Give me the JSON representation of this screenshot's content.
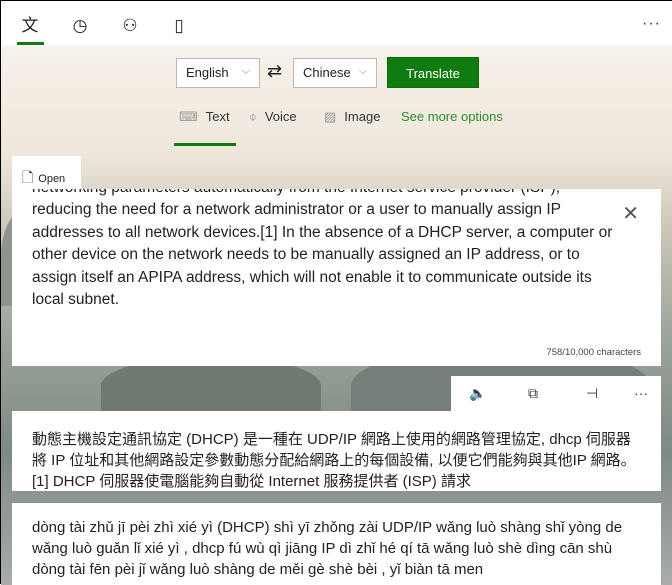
{
  "nav": {
    "items": [
      {
        "icon": "translator-icon",
        "glyph": "文"
      },
      {
        "icon": "history-icon",
        "glyph": "◷"
      },
      {
        "icon": "conversation-icon",
        "glyph": "⚇"
      },
      {
        "icon": "phrasebook-icon",
        "glyph": "▯"
      }
    ],
    "more": "···"
  },
  "languages": {
    "from": "English",
    "to": "Chinese",
    "translate_label": "Translate"
  },
  "modes": [
    {
      "label": "Text",
      "icon": "keyboard-icon",
      "glyph": "⌨"
    },
    {
      "label": "Voice",
      "icon": "microphone-icon",
      "glyph": "🎙"
    },
    {
      "label": "Image",
      "icon": "image-icon",
      "glyph": "▨"
    }
  ],
  "see_more": "See more options",
  "open_label": "Open",
  "source": {
    "text": "automatically. A DHCP server enables computers to request IP addresses and networking parameters automatically from the Internet service provider (ISP), reducing the need for a network administrator or a user to manually assign IP addresses to all network devices.[1] In the absence of a DHCP server, a computer or other device on the network needs to be manually assigned an IP address, or to assign itself an APIPA address, which will not enable it to communicate outside its local subnet.",
    "count": "758/10,000 characters"
  },
  "output": {
    "text": "動態主機設定通訊協定 (DHCP) 是一種在 UDP/IP 網路上使用的網路管理協定, dhcp 伺服器將 IP 位址和其他網路設定參數動態分配給網路上的每個設備, 以便它們能夠與其他IP 網路。[1] DHCP 伺服器使電腦能夠自動從 Internet 服務提供者 (ISP) 請求",
    "pinyin": "dòng tài zhǔ jī pèi zhì xié yì (DHCP) shì yī zhǒng zài UDP/IP wǎng luò shàng shǐ yòng de wǎng luò guǎn lǐ xié yì , dhcp fú wù qì jiāng IP dì zhǐ hé qí tā wǎng luò shè dìng cān shù dòng tài fēn pèi jǐ wǎng luò shàng de měi gè shè bèi , yǐ biàn tā men"
  },
  "accent": "#107c10"
}
